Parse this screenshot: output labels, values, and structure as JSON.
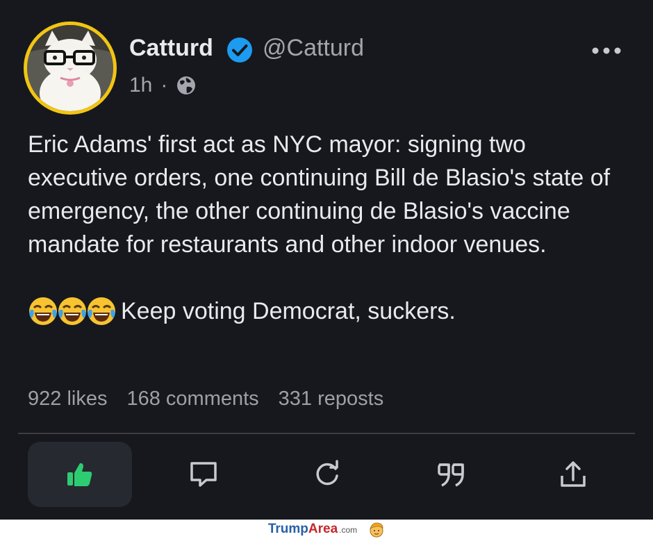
{
  "author": {
    "name": "Catturd",
    "handle": "@Catturd",
    "verified": true,
    "time": "1h",
    "visibility_icon": "globe-icon"
  },
  "post": {
    "text": "Eric Adams' first act as NYC mayor: signing two executive orders, one continuing Bill de Blasio's state of emergency, the other continuing de Blasio's vaccine mandate for restaurants and other indoor venues.",
    "emoji_text": "Keep voting Democrat, suckers.",
    "emojis": [
      "😂",
      "😂",
      "😂"
    ]
  },
  "stats": {
    "likes": "922 likes",
    "comments": "168 comments",
    "reposts": "331 reposts"
  },
  "actions": [
    "thumbs-up-icon",
    "comment-icon",
    "repost-icon",
    "quote-icon",
    "share-icon"
  ],
  "footer": {
    "brand_trump": "Trump",
    "brand_area": "Area",
    "brand_com": ".com"
  },
  "colors": {
    "background": "#16181d",
    "accent_like": "#2ecc71",
    "verified": "#1d9bf0",
    "avatar_ring": "#f2c511"
  }
}
